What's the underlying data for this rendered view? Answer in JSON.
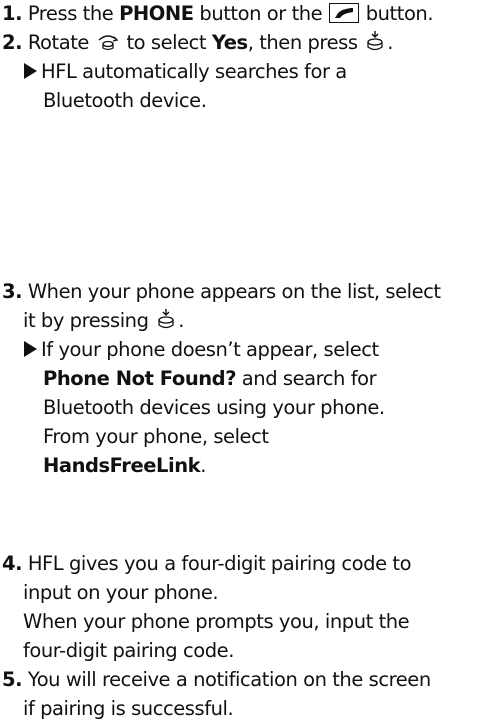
{
  "steps": [
    {
      "number": "1.",
      "text_a": "Press the ",
      "bold_a": "PHONE",
      "text_b": " button or the ",
      "text_c": " button."
    },
    {
      "number": "2.",
      "text_a": "Rotate ",
      "text_b": " to select ",
      "bold_a": "Yes",
      "text_c": ", then press ",
      "text_d": ".",
      "result_l1": "HFL automatically searches for a",
      "result_l2": "Bluetooth device."
    },
    {
      "number": "3.",
      "line1": "When your phone appears on the list, select",
      "line2_a": "it by pressing ",
      "line2_b": ".",
      "result_l1": "If your phone doesn’t appear, select",
      "result_bold1": "Phone Not Found?",
      "result_l2b": " and search for",
      "result_l3": "Bluetooth devices using your phone.",
      "result_l4": "From your phone, select",
      "result_bold2": "HandsFreeLink",
      "result_l5b": "."
    },
    {
      "number": "4.",
      "line1": "HFL gives you a four-digit pairing code to",
      "line2": "input on your phone.",
      "line3": "When your phone prompts you, input the",
      "line4": "four-digit pairing code."
    },
    {
      "number": "5.",
      "line1": "You will receive a notification on the screen",
      "line2": "if pairing is successful."
    }
  ],
  "icons": {
    "phone_button": "phone-handset-icon",
    "interface_dial_rotate": "interface-dial-rotate-icon",
    "interface_dial_press": "interface-dial-press-icon",
    "result_arrow": "triangle-arrow-icon"
  }
}
